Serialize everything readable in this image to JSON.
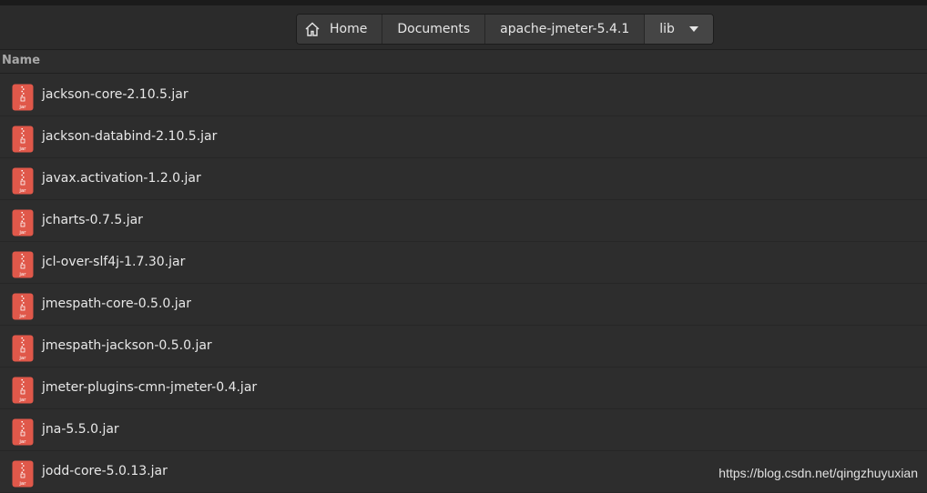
{
  "pathbar": {
    "crumbs": [
      "Home",
      "Documents",
      "apache-jmeter-5.4.1",
      "lib"
    ]
  },
  "columns": {
    "name": "Name"
  },
  "files": [
    {
      "name": "jackson-core-2.10.5.jar",
      "icon": "jar-archive-icon",
      "icon_label": "jar"
    },
    {
      "name": "jackson-databind-2.10.5.jar",
      "icon": "jar-archive-icon",
      "icon_label": "jar"
    },
    {
      "name": "javax.activation-1.2.0.jar",
      "icon": "jar-archive-icon",
      "icon_label": "jar"
    },
    {
      "name": "jcharts-0.7.5.jar",
      "icon": "jar-archive-icon",
      "icon_label": "jar"
    },
    {
      "name": "jcl-over-slf4j-1.7.30.jar",
      "icon": "jar-archive-icon",
      "icon_label": "jar"
    },
    {
      "name": "jmespath-core-0.5.0.jar",
      "icon": "jar-archive-icon",
      "icon_label": "jar"
    },
    {
      "name": "jmespath-jackson-0.5.0.jar",
      "icon": "jar-archive-icon",
      "icon_label": "jar"
    },
    {
      "name": "jmeter-plugins-cmn-jmeter-0.4.jar",
      "icon": "jar-archive-icon",
      "icon_label": "jar"
    },
    {
      "name": "jna-5.5.0.jar",
      "icon": "jar-archive-icon",
      "icon_label": "jar"
    },
    {
      "name": "jodd-core-5.0.13.jar",
      "icon": "jar-archive-icon",
      "icon_label": "jar"
    }
  ],
  "watermark": "https://blog.csdn.net/qingzhuyuxian",
  "colors": {
    "background": "#2d2d2d",
    "icon_red": "#e0584a",
    "text": "#e8e8e8"
  }
}
